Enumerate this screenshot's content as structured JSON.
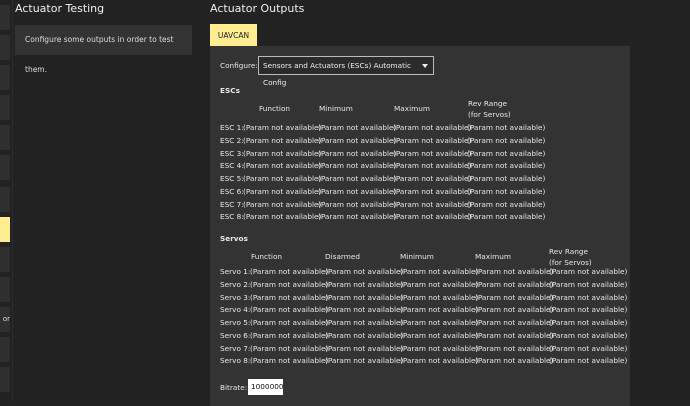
{
  "sidebar": {
    "items": [
      {
        "label": ""
      },
      {
        "label": ""
      },
      {
        "label": ""
      },
      {
        "label": ""
      },
      {
        "label": ""
      },
      {
        "label": ""
      },
      {
        "label": ""
      },
      {
        "label": "",
        "active": true
      },
      {
        "label": ""
      },
      {
        "label": ""
      },
      {
        "label": "or"
      },
      {
        "label": ""
      },
      {
        "label": ""
      }
    ]
  },
  "testing": {
    "title": "Actuator Testing",
    "message": "Configure some outputs in order to test them."
  },
  "outputs": {
    "title": "Actuator Outputs",
    "tab": "UAVCAN",
    "configure_label": "Configure:",
    "configure_value": "Sensors and Actuators (ESCs) Automatic Config",
    "escs": {
      "title": "ESCs",
      "headers": [
        "Function",
        "Minimum",
        "Maximum",
        "Rev Range",
        "(for Servos)"
      ],
      "rows": [
        {
          "label": "ESC 1:",
          "values": [
            "(Param not available)",
            "(Param not available)",
            "(Param not available)",
            "(Param not available)"
          ]
        },
        {
          "label": "ESC 2:",
          "values": [
            "(Param not available)",
            "(Param not available)",
            "(Param not available)",
            "(Param not available)"
          ]
        },
        {
          "label": "ESC 3:",
          "values": [
            "(Param not available)",
            "(Param not available)",
            "(Param not available)",
            "(Param not available)"
          ]
        },
        {
          "label": "ESC 4:",
          "values": [
            "(Param not available)",
            "(Param not available)",
            "(Param not available)",
            "(Param not available)"
          ]
        },
        {
          "label": "ESC 5:",
          "values": [
            "(Param not available)",
            "(Param not available)",
            "(Param not available)",
            "(Param not available)"
          ]
        },
        {
          "label": "ESC 6:",
          "values": [
            "(Param not available)",
            "(Param not available)",
            "(Param not available)",
            "(Param not available)"
          ]
        },
        {
          "label": "ESC 7:",
          "values": [
            "(Param not available)",
            "(Param not available)",
            "(Param not available)",
            "(Param not available)"
          ]
        },
        {
          "label": "ESC 8:",
          "values": [
            "(Param not available)",
            "(Param not available)",
            "(Param not available)",
            "(Param not available)"
          ]
        }
      ]
    },
    "servos": {
      "title": "Servos",
      "headers": [
        "Function",
        "Disarmed",
        "Minimum",
        "Maximum",
        "Rev Range",
        "(for Servos)"
      ],
      "rows": [
        {
          "label": "Servo 1:",
          "values": [
            "(Param not available)",
            "(Param not available)",
            "(Param not available)",
            "(Param not available)",
            "(Param not available)"
          ]
        },
        {
          "label": "Servo 2:",
          "values": [
            "(Param not available)",
            "(Param not available)",
            "(Param not available)",
            "(Param not available)",
            "(Param not available)"
          ]
        },
        {
          "label": "Servo 3:",
          "values": [
            "(Param not available)",
            "(Param not available)",
            "(Param not available)",
            "(Param not available)",
            "(Param not available)"
          ]
        },
        {
          "label": "Servo 4:",
          "values": [
            "(Param not available)",
            "(Param not available)",
            "(Param not available)",
            "(Param not available)",
            "(Param not available)"
          ]
        },
        {
          "label": "Servo 5:",
          "values": [
            "(Param not available)",
            "(Param not available)",
            "(Param not available)",
            "(Param not available)",
            "(Param not available)"
          ]
        },
        {
          "label": "Servo 6:",
          "values": [
            "(Param not available)",
            "(Param not available)",
            "(Param not available)",
            "(Param not available)",
            "(Param not available)"
          ]
        },
        {
          "label": "Servo 7:",
          "values": [
            "(Param not available)",
            "(Param not available)",
            "(Param not available)",
            "(Param not available)",
            "(Param not available)"
          ]
        },
        {
          "label": "Servo 8:",
          "values": [
            "(Param not available)",
            "(Param not available)",
            "(Param not available)",
            "(Param not available)",
            "(Param not available)"
          ]
        }
      ]
    },
    "bitrate_label": "Bitrate:",
    "bitrate_value": "1000000"
  },
  "colors": {
    "accent": "#ffed8f",
    "background": "#222222",
    "panel": "#333333"
  }
}
